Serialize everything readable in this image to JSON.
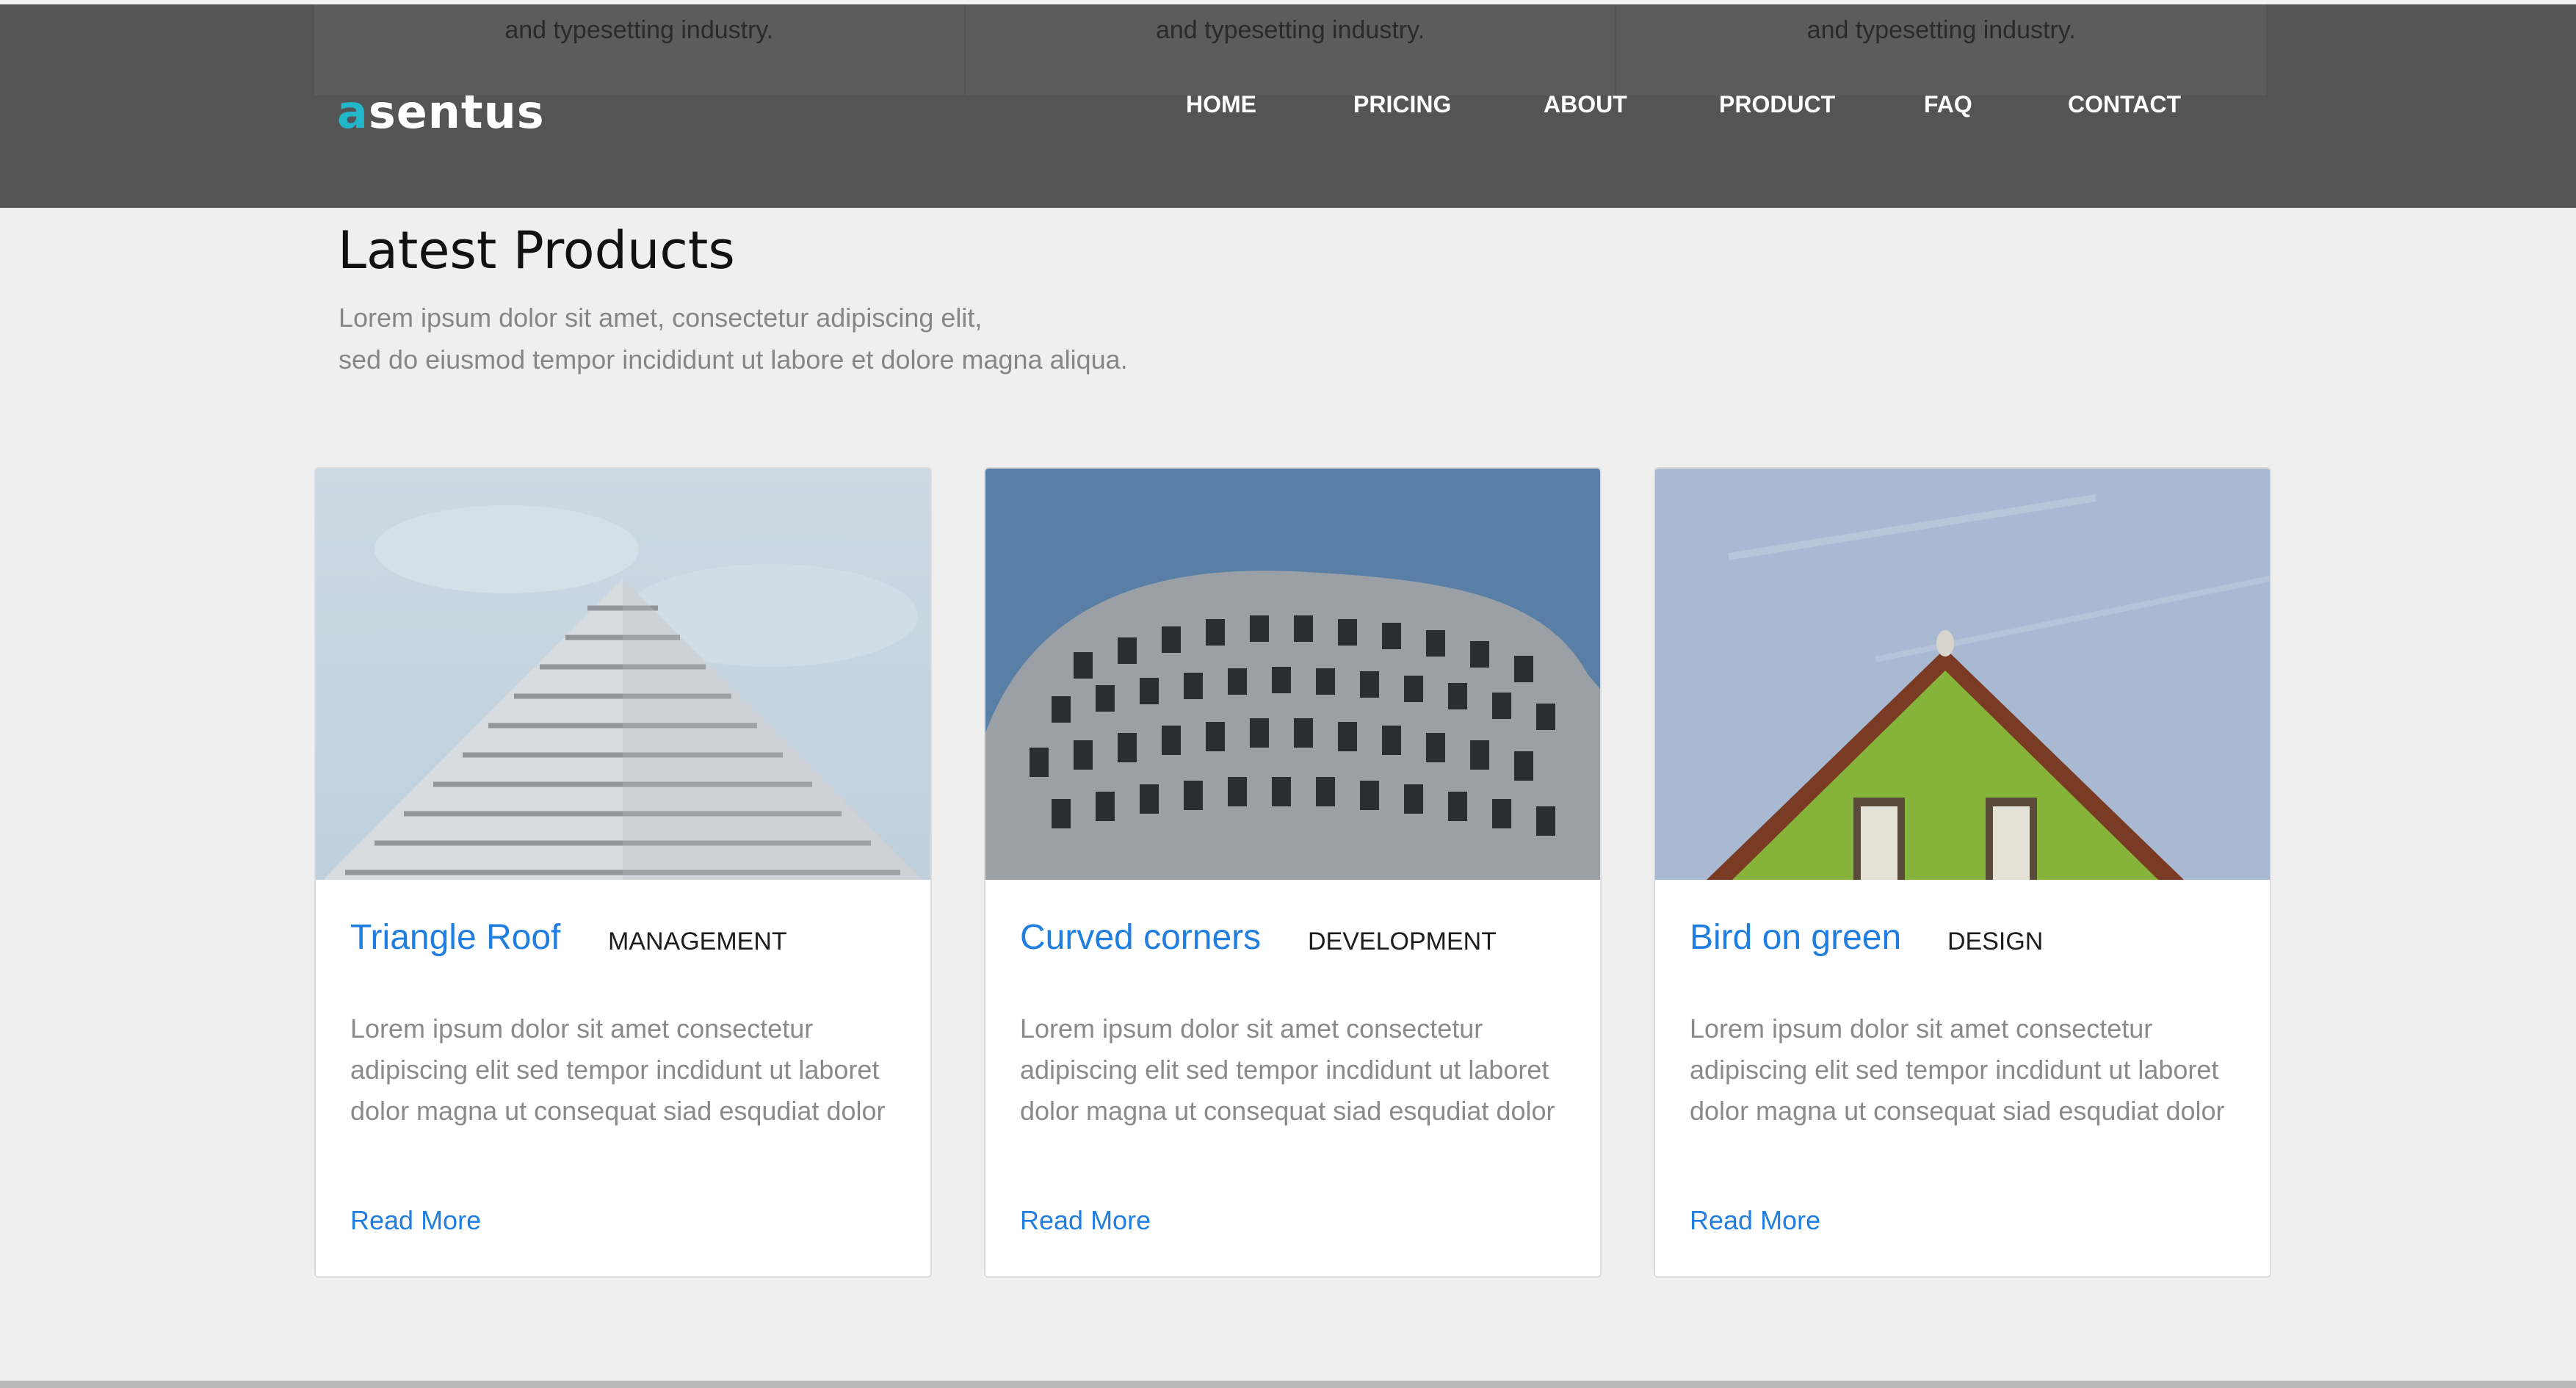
{
  "header": {
    "ghost_text": [
      "and typesetting industry.",
      "and typesetting industry.",
      "and typesetting industry."
    ],
    "logo_accent": "a",
    "logo_rest": "sentus",
    "nav": [
      "HOME",
      "PRICING",
      "ABOUT",
      "PRODUCT",
      "FAQ",
      "CONTACT"
    ]
  },
  "section": {
    "title": "Latest Products",
    "subtitle_line1": "Lorem ipsum dolor sit amet, consectetur adipiscing elit,",
    "subtitle_line2": "sed do eiusmod tempor incididunt ut labore et dolore magna aliqua."
  },
  "cards": [
    {
      "title": "Triangle Roof",
      "tag": "MANAGEMENT",
      "body": "Lorem ipsum dolor sit amet consectetur adipiscing elit sed tempor incdidunt ut laboret dolor magna ut consequat siad esqudiat dolor",
      "link": "Read More"
    },
    {
      "title": "Curved corners",
      "tag": "DEVELOPMENT",
      "body": "Lorem ipsum dolor sit amet consectetur adipiscing elit sed tempor incdidunt ut laboret dolor magna ut consequat siad esqudiat dolor",
      "link": "Read More"
    },
    {
      "title": "Bird on green",
      "tag": "DESIGN",
      "body": "Lorem ipsum dolor sit amet consectetur adipiscing elit sed tempor incdidunt ut laboret dolor magna ut consequat siad esqudiat dolor",
      "link": "Read More"
    }
  ],
  "colors": {
    "header_bg": "#545454",
    "logo_accent": "#21b6c9",
    "link_blue": "#1f7ee0",
    "page_bg": "#efefef"
  }
}
